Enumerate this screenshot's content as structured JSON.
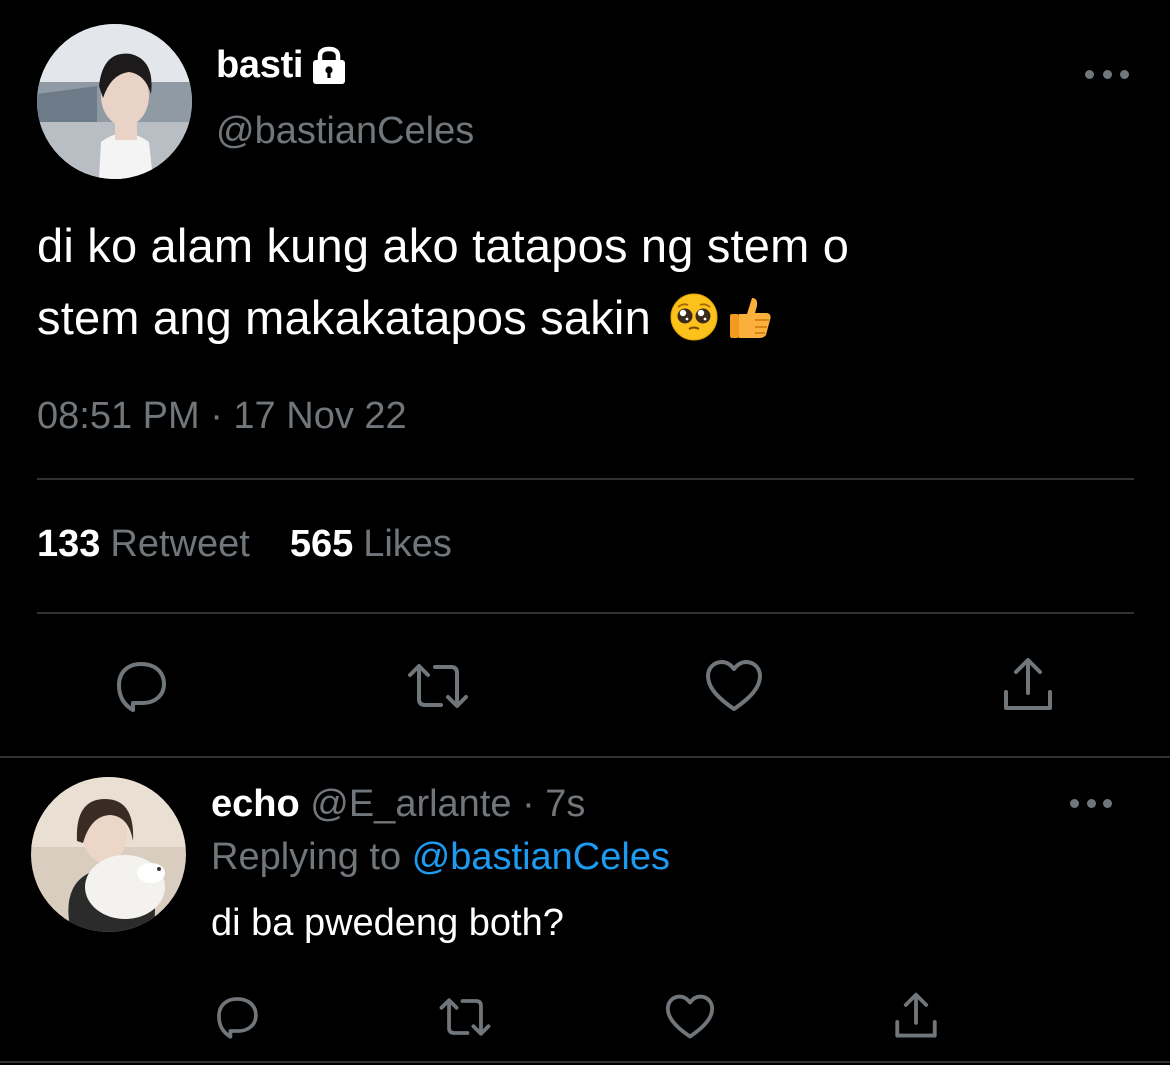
{
  "tweet": {
    "display_name": "basti",
    "handle": "@bastianCeles",
    "protected_icon": "lock-icon",
    "text_lines": [
      "di ko alam kung ako tatapos ng stem o",
      "stem ang makakatapos sakin"
    ],
    "emojis": [
      "pleading-face-emoji",
      "thumbs-up-emoji"
    ],
    "timestamp": "08:51 PM · 17 Nov 22",
    "stats": {
      "retweets_count": "133",
      "retweets_label": "Retweet",
      "likes_count": "565",
      "likes_label": "Likes"
    },
    "actions": [
      "reply-icon",
      "retweet-icon",
      "like-icon",
      "share-icon"
    ]
  },
  "reply": {
    "display_name": "echo",
    "meta": "@E_arlante · 7s",
    "replying_prefix": "Replying to",
    "replying_to": "@bastianCeles",
    "text": "di ba pwedeng both?",
    "actions": [
      "reply-icon",
      "retweet-icon",
      "like-icon",
      "share-icon"
    ]
  },
  "colors": {
    "background": "#000000",
    "text_primary": "#ffffff",
    "text_secondary": "#71767b",
    "link": "#1d9bf0",
    "divider": "#2f3336"
  }
}
